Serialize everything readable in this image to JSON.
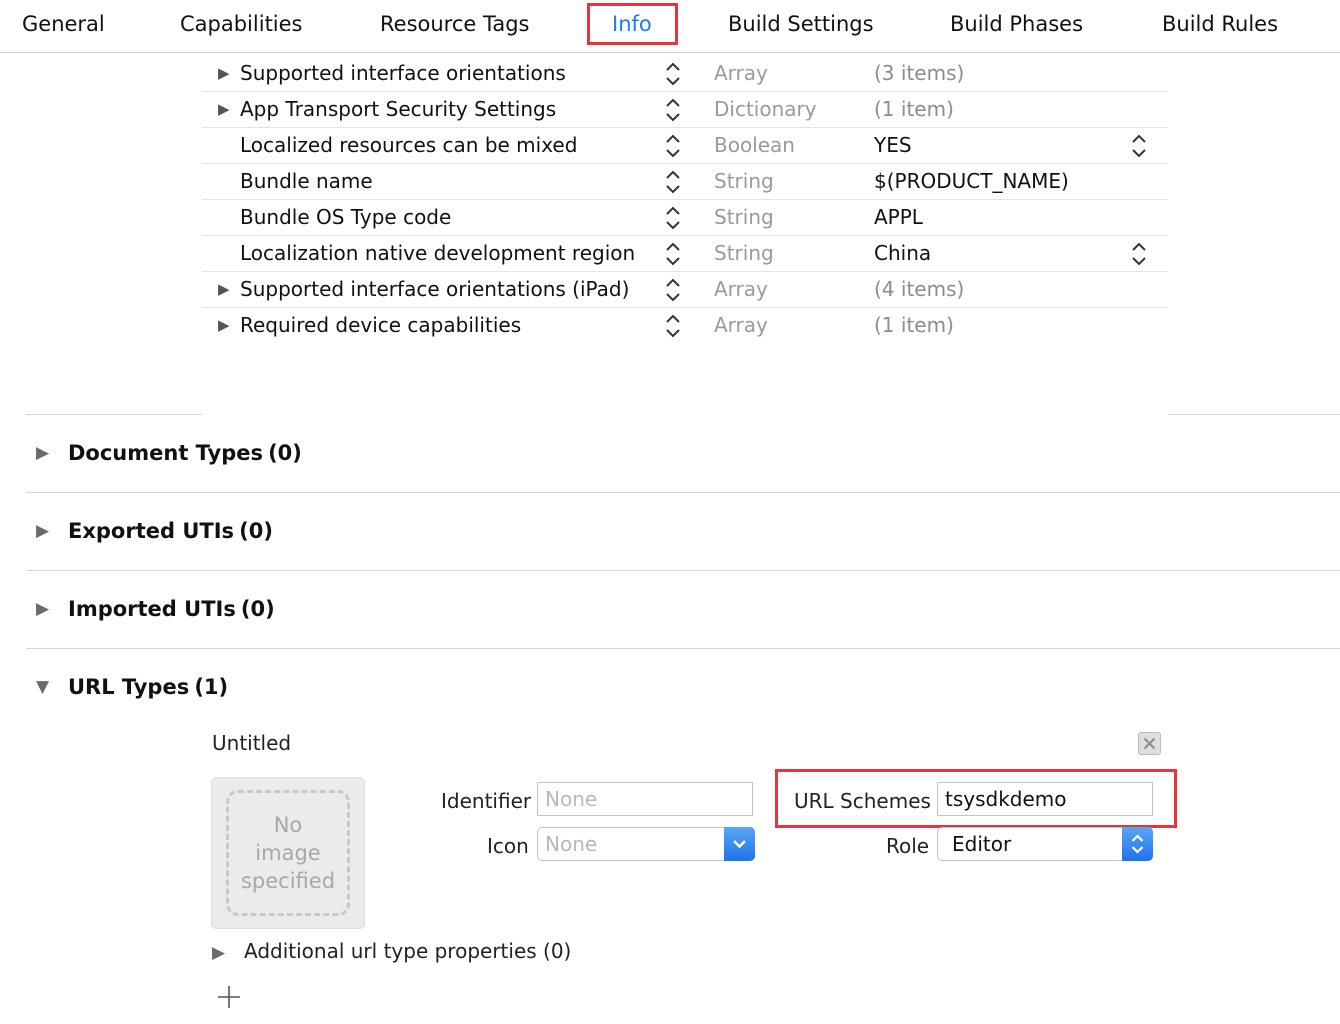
{
  "tabs": [
    "General",
    "Capabilities",
    "Resource Tags",
    "Info",
    "Build Settings",
    "Build Phases",
    "Build Rules"
  ],
  "active_tab": "Info",
  "properties": [
    {
      "key": "Supported interface orientations",
      "type": "Array",
      "value": "(3 items)",
      "expandable": true,
      "value_popup": false
    },
    {
      "key": "App Transport Security Settings",
      "type": "Dictionary",
      "value": "(1 item)",
      "expandable": true,
      "value_popup": false
    },
    {
      "key": "Localized resources can be mixed",
      "type": "Boolean",
      "value": "YES",
      "expandable": false,
      "value_popup": true
    },
    {
      "key": "Bundle name",
      "type": "String",
      "value": "$(PRODUCT_NAME)",
      "expandable": false,
      "value_popup": false
    },
    {
      "key": "Bundle OS Type code",
      "type": "String",
      "value": "APPL",
      "expandable": false,
      "value_popup": false
    },
    {
      "key": "Localization native development region",
      "type": "String",
      "value": "China",
      "expandable": false,
      "value_popup": true
    },
    {
      "key": "Supported interface orientations (iPad)",
      "type": "Array",
      "value": "(4 items)",
      "expandable": true,
      "value_popup": false
    },
    {
      "key": "Required device capabilities",
      "type": "Array",
      "value": "(1 item)",
      "expandable": true,
      "value_popup": false
    }
  ],
  "sections": [
    {
      "title": "Document Types",
      "count": "(0)",
      "expanded": false
    },
    {
      "title": "Exported UTIs",
      "count": "(0)",
      "expanded": false
    },
    {
      "title": "Imported UTIs",
      "count": "(0)",
      "expanded": false
    },
    {
      "title": "URL Types",
      "count": "(1)",
      "expanded": true
    }
  ],
  "url_type": {
    "name": "Untitled",
    "image_placeholder": [
      "No",
      "image",
      "specified"
    ],
    "identifier_label": "Identifier",
    "identifier_placeholder": "None",
    "icon_label": "Icon",
    "icon_placeholder": "None",
    "url_schemes_label": "URL Schemes",
    "url_schemes_value": "tsysdkdemo",
    "role_label": "Role",
    "role_value": "Editor",
    "additional_properties": "Additional url type properties (0)"
  },
  "icons": {
    "disclosure_closed": "▶",
    "disclosure_open": "▼",
    "add": "plus-icon",
    "remove": "close-icon"
  },
  "colors": {
    "accent": "#1a7df0",
    "highlight": "#e8353a",
    "popup_blue": "#2f80ef"
  }
}
